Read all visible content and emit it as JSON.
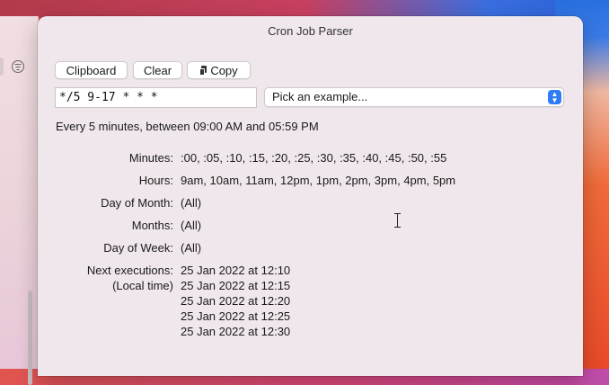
{
  "window": {
    "title": "Cron Job Parser"
  },
  "toolbar": {
    "clipboard_label": "Clipboard",
    "clear_label": "Clear",
    "copy_label": "Copy",
    "copy_icon": "copy-doc-icon"
  },
  "expression": {
    "value": "*/5 9-17 * * *"
  },
  "examples": {
    "selected": "Pick an example..."
  },
  "summary": "Every 5 minutes, between 09:00 AM and 05:59 PM",
  "fields": {
    "minutes": {
      "label": "Minutes:",
      "value": ":00, :05, :10, :15, :20, :25, :30, :35, :40, :45, :50, :55"
    },
    "hours": {
      "label": "Hours:",
      "value": "9am, 10am, 11am, 12pm, 1pm, 2pm, 3pm, 4pm, 5pm"
    },
    "day_of_month": {
      "label": "Day of Month:",
      "value": "(All)"
    },
    "months": {
      "label": "Months:",
      "value": "(All)"
    },
    "day_of_week": {
      "label": "Day of Week:",
      "value": "(All)"
    }
  },
  "next": {
    "label": "Next executions:",
    "sublabel": "(Local time)",
    "items": [
      "25 Jan 2022 at 12:10",
      "25 Jan 2022 at 12:15",
      "25 Jan 2022 at 12:20",
      "25 Jan 2022 at 12:25",
      "25 Jan 2022 at 12:30"
    ]
  },
  "colors": {
    "accent": "#2f7cf6",
    "window_bg": "#efe7ec"
  }
}
